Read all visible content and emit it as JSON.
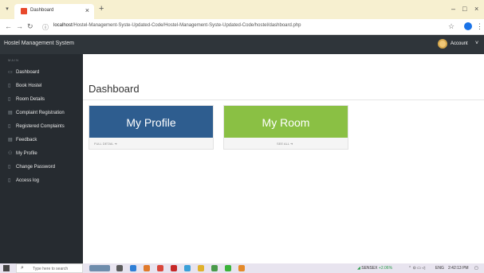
{
  "browser": {
    "tab_title": "Dashboard",
    "url_host": "localhost",
    "url_path": "/Hostel-Management-Syste-Updated-Code/Hostel-Management-Syste-Updated-Code/hostel/dashboard.php"
  },
  "header": {
    "brand": "Hostel Management System",
    "account_label": "Account"
  },
  "sidebar": {
    "heading": "MAIN",
    "items": [
      {
        "label": "Dashboard",
        "icon": "dashboard-icon"
      },
      {
        "label": "Book Hostel",
        "icon": "file-icon"
      },
      {
        "label": "Room Details",
        "icon": "file-icon"
      },
      {
        "label": "Complaint Registration",
        "icon": "files-icon"
      },
      {
        "label": "Registered Complaints",
        "icon": "file-icon"
      },
      {
        "label": "Feedback",
        "icon": "files-icon"
      },
      {
        "label": "My Profile",
        "icon": "user-icon"
      },
      {
        "label": "Change Password",
        "icon": "file-icon"
      },
      {
        "label": "Access log",
        "icon": "file-icon"
      }
    ]
  },
  "main": {
    "title": "Dashboard",
    "cards": [
      {
        "title": "My Profile",
        "link": "FULL DETAIL",
        "color": "#2e5d8f"
      },
      {
        "title": "My Room",
        "link": "SEE ALL",
        "color": "#8ac044"
      }
    ]
  },
  "taskbar": {
    "search_placeholder": "Type here to search",
    "sensex_label": "SENSEX",
    "sensex_change": "+2.06%",
    "lang": "ENG",
    "time": "2:42:13 PM"
  },
  "colors": {
    "header_bg": "#2f353a",
    "sidebar_bg": "#262b30",
    "tabstrip_bg": "#f7f0d0"
  }
}
